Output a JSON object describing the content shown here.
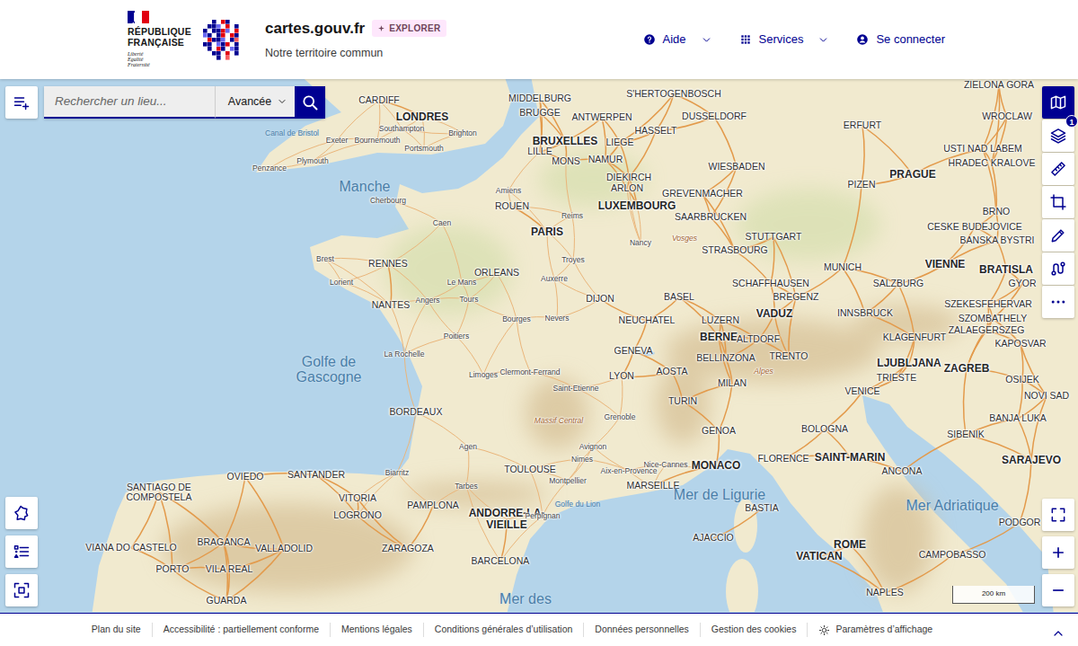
{
  "header": {
    "brand_lines": [
      "RÉPUBLIQUE",
      "FRANÇAISE"
    ],
    "motto": [
      "Liberté",
      "Égalité",
      "Fraternité"
    ],
    "site_title": "cartes.gouv.fr",
    "badge": "EXPLORER",
    "tagline": "Notre territoire commun",
    "nav": [
      {
        "label": "Aide",
        "has_menu": true
      },
      {
        "label": "Services",
        "has_menu": true
      },
      {
        "label": "Se connecter",
        "has_menu": false
      }
    ]
  },
  "search": {
    "placeholder": "Rechercher un lieu...",
    "mode": "Avancée"
  },
  "tools": [
    {
      "selected": true
    },
    {
      "selected": false,
      "badge": "1"
    },
    {
      "selected": false
    },
    {
      "selected": false
    },
    {
      "selected": false
    },
    {
      "selected": false
    },
    {
      "selected": false
    }
  ],
  "scale": {
    "label": "200 km"
  },
  "map": {
    "labels": [
      {
        "text": "CARDIFF",
        "kind": "city"
      },
      {
        "text": "LONDRES",
        "kind": "capital"
      },
      {
        "text": "MIDDELBURG",
        "kind": "city"
      },
      {
        "text": "S'HERTOGENBOSCH",
        "kind": "city"
      },
      {
        "text": "BRUGGE",
        "kind": "city"
      },
      {
        "text": "ANTWERPEN",
        "kind": "city"
      },
      {
        "text": "HASSELT",
        "kind": "city"
      },
      {
        "text": "DUSSELDORF",
        "kind": "city"
      },
      {
        "text": "ERFURT",
        "kind": "city"
      },
      {
        "text": "WROCLAW",
        "kind": "city"
      },
      {
        "text": "ZIELONA GORA",
        "kind": "city"
      },
      {
        "text": "BRUXELLES",
        "kind": "capital"
      },
      {
        "text": "LIEGE",
        "kind": "city"
      },
      {
        "text": "LILLE",
        "kind": "city"
      },
      {
        "text": "MONS",
        "kind": "city"
      },
      {
        "text": "NAMUR",
        "kind": "city"
      },
      {
        "text": "WIESBADEN",
        "kind": "city"
      },
      {
        "text": "USTI NAD LABEM",
        "kind": "city"
      },
      {
        "text": "HRADEC KRALOVE",
        "kind": "city"
      },
      {
        "text": "PRAGUE",
        "kind": "capital"
      },
      {
        "text": "DIEKIRCH",
        "kind": "city"
      },
      {
        "text": "ARLON",
        "kind": "city"
      },
      {
        "text": "GREVENMACHER",
        "kind": "city"
      },
      {
        "text": "LUXEMBOURG",
        "kind": "capital"
      },
      {
        "text": "PIZEN",
        "kind": "city"
      },
      {
        "text": "SAARBRUCKEN",
        "kind": "city"
      },
      {
        "text": "ROUEN",
        "kind": "city"
      },
      {
        "text": "BRNO",
        "kind": "city"
      },
      {
        "text": "CESKE BUDEJOVICE",
        "kind": "city"
      },
      {
        "text": "PARIS",
        "kind": "capital"
      },
      {
        "text": "STUTTGART",
        "kind": "city"
      },
      {
        "text": "BANSKA BYSTRI",
        "kind": "city"
      },
      {
        "text": "STRASBOURG",
        "kind": "city"
      },
      {
        "text": "RENNES",
        "kind": "city"
      },
      {
        "text": "VIENNE",
        "kind": "capital"
      },
      {
        "text": "BRATISLA",
        "kind": "capital"
      },
      {
        "text": "MUNICH",
        "kind": "city"
      },
      {
        "text": "ORLEANS",
        "kind": "city"
      },
      {
        "text": "SALZBURG",
        "kind": "city"
      },
      {
        "text": "GYOR",
        "kind": "city"
      },
      {
        "text": "SCHAFFHAUSEN",
        "kind": "city"
      },
      {
        "text": "BASEL",
        "kind": "city"
      },
      {
        "text": "BREGENZ",
        "kind": "city"
      },
      {
        "text": "DIJON",
        "kind": "city"
      },
      {
        "text": "NANTES",
        "kind": "city"
      },
      {
        "text": "SZEKESFEHERVAR",
        "kind": "city"
      },
      {
        "text": "VADUZ",
        "kind": "capital"
      },
      {
        "text": "INNSBRUCK",
        "kind": "city"
      },
      {
        "text": "NEUCHATEL",
        "kind": "city"
      },
      {
        "text": "LUZERN",
        "kind": "city"
      },
      {
        "text": "SZOMBATHELY",
        "kind": "city"
      },
      {
        "text": "ZALAEGERSZEG",
        "kind": "city"
      },
      {
        "text": "BERNE",
        "kind": "capital"
      },
      {
        "text": "ALTDORF",
        "kind": "city"
      },
      {
        "text": "KLAGENFURT",
        "kind": "city"
      },
      {
        "text": "KAPOSVAR",
        "kind": "city"
      },
      {
        "text": "GENEVA",
        "kind": "city"
      },
      {
        "text": "BELLINZONA",
        "kind": "city"
      },
      {
        "text": "TRENTO",
        "kind": "city"
      },
      {
        "text": "LJUBLJANA",
        "kind": "capital"
      },
      {
        "text": "ZAGREB",
        "kind": "capital"
      },
      {
        "text": "TRIESTE",
        "kind": "city"
      },
      {
        "text": "OSIJEK",
        "kind": "city"
      },
      {
        "text": "LYON",
        "kind": "city"
      },
      {
        "text": "AOSTA",
        "kind": "city"
      },
      {
        "text": "MILAN",
        "kind": "city"
      },
      {
        "text": "VENICE",
        "kind": "city"
      },
      {
        "text": "TURIN",
        "kind": "city"
      },
      {
        "text": "NOVI SAD",
        "kind": "city"
      },
      {
        "text": "BANJA LUKA",
        "kind": "city"
      },
      {
        "text": "BORDEAUX",
        "kind": "city"
      },
      {
        "text": "BOLOGNA",
        "kind": "city"
      },
      {
        "text": "GENOA",
        "kind": "city"
      },
      {
        "text": "SIBENIK",
        "kind": "city"
      },
      {
        "text": "FLORENCE",
        "kind": "city"
      },
      {
        "text": "SAINT-MARIN",
        "kind": "capital"
      },
      {
        "text": "SARAJEVO",
        "kind": "capital"
      },
      {
        "text": "MONACO",
        "kind": "capital"
      },
      {
        "text": "ANCONA",
        "kind": "city"
      },
      {
        "text": "OVIEDO",
        "kind": "city"
      },
      {
        "text": "SANTANDER",
        "kind": "city"
      },
      {
        "text": "TOULOUSE",
        "kind": "city"
      },
      {
        "text": "SANTIAGO DE COMPOSTELA",
        "kind": "city"
      },
      {
        "text": "MARSEILLE",
        "kind": "city"
      },
      {
        "text": "VITORIA",
        "kind": "city"
      },
      {
        "text": "PAMPLONA",
        "kind": "city"
      },
      {
        "text": "LOGRONO",
        "kind": "city"
      },
      {
        "text": "ANDORRE-LA-VIEILLE",
        "kind": "capital"
      },
      {
        "text": "BASTIA",
        "kind": "city"
      },
      {
        "text": "PODGOR",
        "kind": "city"
      },
      {
        "text": "AJACCIO",
        "kind": "city"
      },
      {
        "text": "BRAGANCA",
        "kind": "city"
      },
      {
        "text": "VIANA DO CASTELO",
        "kind": "city"
      },
      {
        "text": "VALLADOLID",
        "kind": "city"
      },
      {
        "text": "ZARAGOZA",
        "kind": "city"
      },
      {
        "text": "ROME",
        "kind": "capital"
      },
      {
        "text": "VATICAN",
        "kind": "capital"
      },
      {
        "text": "CAMPOBASSO",
        "kind": "city"
      },
      {
        "text": "BARCELONA",
        "kind": "city"
      },
      {
        "text": "PORTO",
        "kind": "city"
      },
      {
        "text": "VILA REAL",
        "kind": "city"
      },
      {
        "text": "NAPLES",
        "kind": "city"
      },
      {
        "text": "GUARDA",
        "kind": "city"
      },
      {
        "text": "Exeter",
        "kind": "town"
      },
      {
        "text": "Bournemouth",
        "kind": "town"
      },
      {
        "text": "Southampton",
        "kind": "town"
      },
      {
        "text": "Portsmouth",
        "kind": "town"
      },
      {
        "text": "Brighton",
        "kind": "town"
      },
      {
        "text": "Plymouth",
        "kind": "town"
      },
      {
        "text": "Penzance",
        "kind": "town"
      },
      {
        "text": "Cherbourg",
        "kind": "town"
      },
      {
        "text": "Caen",
        "kind": "town"
      },
      {
        "text": "Amiens",
        "kind": "town"
      },
      {
        "text": "Reims",
        "kind": "town"
      },
      {
        "text": "Brest",
        "kind": "town"
      },
      {
        "text": "Nancy",
        "kind": "town"
      },
      {
        "text": "Troyes",
        "kind": "town"
      },
      {
        "text": "Le Mans",
        "kind": "town"
      },
      {
        "text": "Auxerre",
        "kind": "town"
      },
      {
        "text": "Lorient",
        "kind": "town"
      },
      {
        "text": "Angers",
        "kind": "town"
      },
      {
        "text": "Tours",
        "kind": "town"
      },
      {
        "text": "Bourges",
        "kind": "town"
      },
      {
        "text": "Nevers",
        "kind": "town"
      },
      {
        "text": "Poitiers",
        "kind": "town"
      },
      {
        "text": "La Rochelle",
        "kind": "town"
      },
      {
        "text": "Limoges",
        "kind": "town"
      },
      {
        "text": "Clermont-Ferrand",
        "kind": "town"
      },
      {
        "text": "Saint-Etienne",
        "kind": "town"
      },
      {
        "text": "Grenoble",
        "kind": "town"
      },
      {
        "text": "Agen",
        "kind": "town"
      },
      {
        "text": "Avignon",
        "kind": "town"
      },
      {
        "text": "Nimes",
        "kind": "town"
      },
      {
        "text": "Aix-en-Provence",
        "kind": "town"
      },
      {
        "text": "Nice-Cannes",
        "kind": "town"
      },
      {
        "text": "Montpellier",
        "kind": "town"
      },
      {
        "text": "Biarritz",
        "kind": "town"
      },
      {
        "text": "Tarbes",
        "kind": "town"
      },
      {
        "text": "Perpignan",
        "kind": "town"
      },
      {
        "text": "Manche",
        "kind": "sea"
      },
      {
        "text": "Golfe de Gascogne",
        "kind": "sea"
      },
      {
        "text": "Mer de Ligurie",
        "kind": "sea"
      },
      {
        "text": "Mer Adriatique",
        "kind": "sea"
      },
      {
        "text": "Mer des",
        "kind": "sea"
      },
      {
        "text": "Golfe du Lion",
        "kind": "bay"
      },
      {
        "text": "Canal de Bristol",
        "kind": "bay"
      },
      {
        "text": "Massif Central",
        "kind": "relief"
      },
      {
        "text": "Vosges",
        "kind": "relief"
      },
      {
        "text": "Alpes",
        "kind": "relief"
      }
    ]
  },
  "footer": {
    "links": [
      "Plan du site",
      "Accessibilité : partiellement conforme",
      "Mentions légales",
      "Conditions générales d’utilisation",
      "Données personnelles",
      "Gestion des cookies"
    ],
    "display_settings": "Paramètres d’affichage"
  }
}
